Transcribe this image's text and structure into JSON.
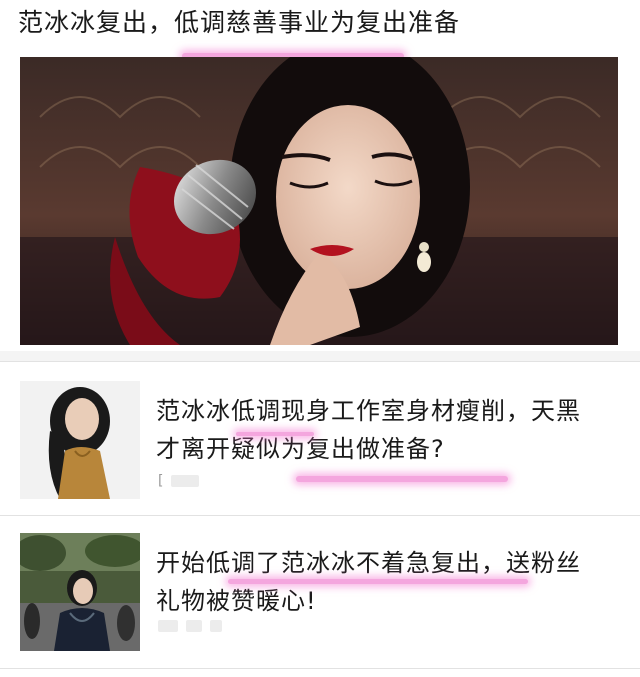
{
  "top_article": {
    "title": "范冰冰复出，低调慈善事业为复出准备"
  },
  "articles": [
    {
      "title": "范冰冰低调现身工作室身材瘦削，天黑才离开疑似为复出做准备?",
      "meta_glyph": "["
    },
    {
      "title": "开始低调了范冰冰不着急复出，送粉丝礼物被赞暖心!"
    }
  ],
  "colors": {
    "highlight": "#f4a6de",
    "divider": "#e2e2e2",
    "text": "#1a1a1a"
  }
}
